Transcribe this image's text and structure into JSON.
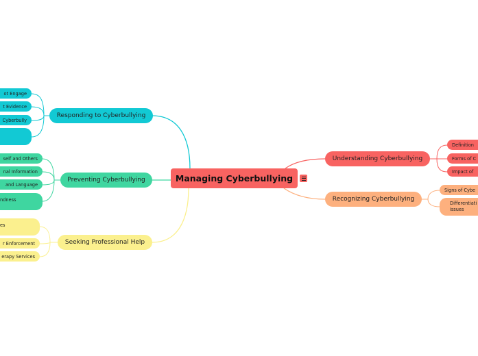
{
  "mindmap": {
    "root": {
      "label": "Managing Cyberbullying",
      "color": "#f86361",
      "menu_icon": "hamburger-menu-icon"
    },
    "branches": [
      {
        "label": "Responding to Cyberbullying",
        "color": "#12c9d4",
        "side": "left",
        "children": [
          {
            "label": "Do Not Engage",
            "visible_text": "ot Engage"
          },
          {
            "label": "Collect Evidence",
            "visible_text": "t Evidence"
          },
          {
            "label": "Block the Cyberbully",
            "visible_text": "Cyberbully"
          },
          {
            "label": "",
            "visible_text": ""
          }
        ]
      },
      {
        "label": "Preventing Cyberbullying",
        "color": "#3fd6a0",
        "side": "left",
        "children": [
          {
            "label": "Respect Yourself and Others",
            "visible_text": "self and Others"
          },
          {
            "label": "Protect Personal Information",
            "visible_text": "nal Information"
          },
          {
            "label": "Mind Your Words and Language",
            "visible_text": " and Language"
          },
          {
            "label": "Promote Kindness",
            "visible_text": "ndness"
          }
        ]
      },
      {
        "label": "Seeking Professional Help",
        "color": "#fbf08e",
        "side": "left",
        "children": [
          {
            "label": "Resources",
            "visible_text": "es"
          },
          {
            "label": "Law Enforcement",
            "visible_text": "r Enforcement"
          },
          {
            "label": "Therapy Services",
            "visible_text": "erapy Services"
          }
        ]
      },
      {
        "label": "Understanding Cyberbullying",
        "color": "#f86361",
        "side": "right",
        "children": [
          {
            "label": "Definition",
            "visible_text": "Definition"
          },
          {
            "label": "Forms of Cyberbullying",
            "visible_text": "Forms of C"
          },
          {
            "label": "Impact of Cyberbullying",
            "visible_text": "Impact of"
          }
        ]
      },
      {
        "label": "Recognizing Cyberbullying",
        "color": "#fdb07e",
        "side": "right",
        "children": [
          {
            "label": "Signs of Cyberbullying",
            "visible_text": "Signs of Cybe"
          },
          {
            "label": "Differentiating issues",
            "visible_text": "Differentiati issues"
          }
        ]
      }
    ]
  }
}
